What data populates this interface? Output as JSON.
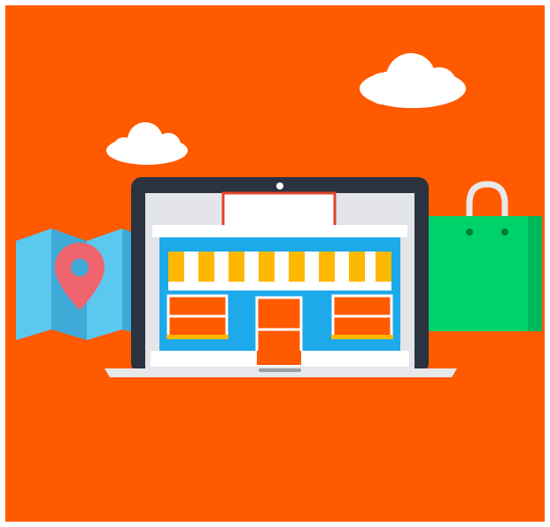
{
  "illustration": {
    "colors": {
      "background": "#FF5A00",
      "cloud": "#FFFFFF",
      "map_light": "#5BC8F0",
      "map_dark": "#3FA9D8",
      "pin": "#F0646E",
      "laptop_bezel": "#2B3340",
      "laptop_base": "#E6E8EB",
      "shop_wall": "#1EA9EA",
      "shop_sign": "#FFFFFF",
      "shop_trim": "#E0422A",
      "awning_stripe": "#FFB800",
      "door_and_windows": "#FF5A00",
      "bag": "#00D26A",
      "bag_side": "#00B85C",
      "bag_handle": "#E8E8E8"
    },
    "icons": [
      "cloud-icon",
      "folded-map-icon",
      "location-pin-icon",
      "laptop-icon",
      "storefront-icon",
      "shopping-bag-icon"
    ]
  }
}
